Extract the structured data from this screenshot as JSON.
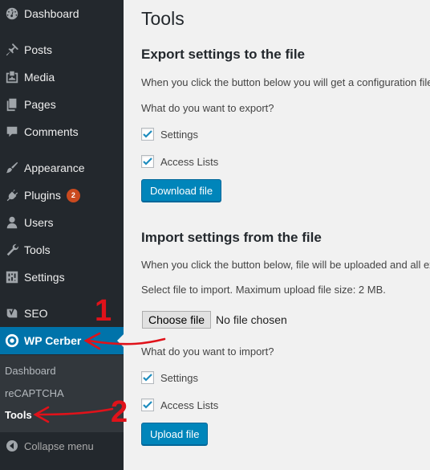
{
  "sidebar": {
    "items": [
      {
        "label": "Dashboard",
        "icon": "dashboard-icon"
      },
      {
        "label": "Posts",
        "icon": "pushpin-icon"
      },
      {
        "label": "Media",
        "icon": "media-icon"
      },
      {
        "label": "Pages",
        "icon": "pages-icon"
      },
      {
        "label": "Comments",
        "icon": "comment-icon"
      },
      {
        "label": "Appearance",
        "icon": "brush-icon"
      },
      {
        "label": "Plugins",
        "icon": "plug-icon",
        "badge": "2"
      },
      {
        "label": "Users",
        "icon": "user-icon"
      },
      {
        "label": "Tools",
        "icon": "wrench-icon"
      },
      {
        "label": "Settings",
        "icon": "sliders-icon"
      },
      {
        "label": "SEO",
        "icon": "yoast-icon"
      },
      {
        "label": "WP Cerber",
        "icon": "cerber-icon"
      }
    ],
    "submenu": [
      "Dashboard",
      "reCAPTCHA",
      "Tools"
    ],
    "collapse_label": "Collapse menu",
    "active_color": "#0073aa",
    "bg_color": "#23282d"
  },
  "main": {
    "title": "Tools",
    "export": {
      "heading": "Export settings to the file",
      "description": "When you click the button below you will get a configuration file",
      "question": "What do you want to export?",
      "options": [
        {
          "label": "Settings",
          "checked": true
        },
        {
          "label": "Access Lists",
          "checked": true
        }
      ],
      "button": "Download file"
    },
    "import": {
      "heading": "Import settings from the file",
      "description": "When you click the button below, file will be uploaded and all existing",
      "file_note": "Select file to import. Maximum upload file size: 2 MB.",
      "choose_button": "Choose file",
      "file_status": "No file chosen",
      "question": "What do you want to import?",
      "options": [
        {
          "label": "Settings",
          "checked": true
        },
        {
          "label": "Access Lists",
          "checked": true
        }
      ],
      "button": "Upload file"
    }
  },
  "annotations": {
    "step1": "1",
    "step2": "2",
    "color": "#e0121a"
  }
}
